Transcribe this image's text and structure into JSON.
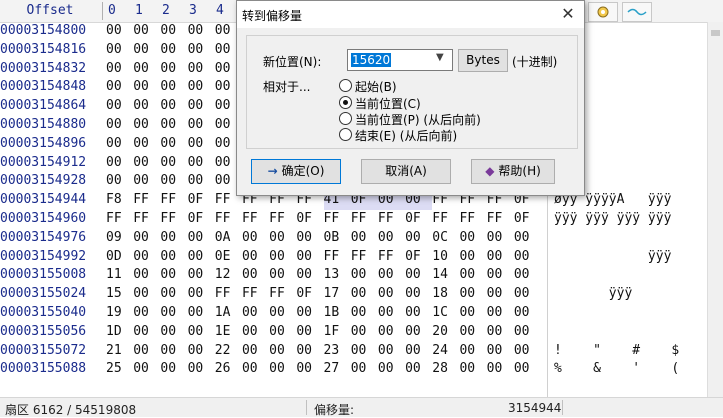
{
  "header": {
    "offset_label": "Offset",
    "columns": [
      "0",
      "1",
      "2",
      "3",
      "4"
    ]
  },
  "offsets": [
    "00003154800",
    "00003154816",
    "00003154832",
    "00003154848",
    "00003154864",
    "00003154880",
    "00003154896",
    "00003154912",
    "00003154928",
    "00003154944",
    "00003154960",
    "00003154976",
    "00003154992",
    "00003155008",
    "00003155024",
    "00003155040",
    "00003155056",
    "00003155072",
    "00003155088"
  ],
  "hex_rows": [
    [
      "00",
      "00",
      "00",
      "00",
      "00",
      "",
      "",
      "",
      "",
      "",
      "",
      "",
      "",
      "",
      "",
      ""
    ],
    [
      "00",
      "00",
      "00",
      "00",
      "00",
      "",
      "",
      "",
      "",
      "",
      "",
      "",
      "",
      "",
      "",
      ""
    ],
    [
      "00",
      "00",
      "00",
      "00",
      "00",
      "",
      "",
      "",
      "",
      "",
      "",
      "",
      "",
      "",
      "",
      ""
    ],
    [
      "00",
      "00",
      "00",
      "00",
      "00",
      "",
      "",
      "",
      "",
      "",
      "",
      "",
      "",
      "",
      "",
      ""
    ],
    [
      "00",
      "00",
      "00",
      "00",
      "00",
      "",
      "",
      "",
      "",
      "",
      "",
      "",
      "",
      "",
      "",
      ""
    ],
    [
      "00",
      "00",
      "00",
      "00",
      "00",
      "",
      "",
      "",
      "",
      "",
      "",
      "",
      "",
      "",
      "",
      ""
    ],
    [
      "00",
      "00",
      "00",
      "00",
      "00",
      "",
      "",
      "",
      "",
      "",
      "",
      "",
      "",
      "",
      "",
      ""
    ],
    [
      "00",
      "00",
      "00",
      "00",
      "00",
      "",
      "",
      "",
      "",
      "",
      "",
      "",
      "",
      "",
      "",
      ""
    ],
    [
      "00",
      "00",
      "00",
      "00",
      "00",
      "",
      "",
      "",
      "",
      "",
      "",
      "",
      "",
      "",
      "",
      ""
    ],
    [
      "F8",
      "FF",
      "FF",
      "0F",
      "FF",
      "FF",
      "FF",
      "FF",
      "41",
      "0F",
      "00",
      "00",
      "FF",
      "FF",
      "FF",
      "0F"
    ],
    [
      "FF",
      "FF",
      "FF",
      "0F",
      "FF",
      "FF",
      "FF",
      "0F",
      "FF",
      "FF",
      "FF",
      "0F",
      "FF",
      "FF",
      "FF",
      "0F"
    ],
    [
      "09",
      "00",
      "00",
      "00",
      "0A",
      "00",
      "00",
      "00",
      "0B",
      "00",
      "00",
      "00",
      "0C",
      "00",
      "00",
      "00"
    ],
    [
      "0D",
      "00",
      "00",
      "00",
      "0E",
      "00",
      "00",
      "00",
      "FF",
      "FF",
      "FF",
      "0F",
      "10",
      "00",
      "00",
      "00"
    ],
    [
      "11",
      "00",
      "00",
      "00",
      "12",
      "00",
      "00",
      "00",
      "13",
      "00",
      "00",
      "00",
      "14",
      "00",
      "00",
      "00"
    ],
    [
      "15",
      "00",
      "00",
      "00",
      "FF",
      "FF",
      "FF",
      "0F",
      "17",
      "00",
      "00",
      "00",
      "18",
      "00",
      "00",
      "00"
    ],
    [
      "19",
      "00",
      "00",
      "00",
      "1A",
      "00",
      "00",
      "00",
      "1B",
      "00",
      "00",
      "00",
      "1C",
      "00",
      "00",
      "00"
    ],
    [
      "1D",
      "00",
      "00",
      "00",
      "1E",
      "00",
      "00",
      "00",
      "1F",
      "00",
      "00",
      "00",
      "20",
      "00",
      "00",
      "00"
    ],
    [
      "21",
      "00",
      "00",
      "00",
      "22",
      "00",
      "00",
      "00",
      "23",
      "00",
      "00",
      "00",
      "24",
      "00",
      "00",
      "00"
    ],
    [
      "25",
      "00",
      "00",
      "00",
      "26",
      "00",
      "00",
      "00",
      "27",
      "00",
      "00",
      "00",
      "28",
      "00",
      "00",
      "00"
    ]
  ],
  "text_rows": [
    "",
    "",
    "",
    "",
    "",
    "",
    "",
    "",
    "",
    "øÿÿ ÿÿÿÿA   ÿÿÿ",
    "ÿÿÿ ÿÿÿ ÿÿÿ ÿÿÿ",
    "",
    "            ÿÿÿ",
    "",
    "       ÿÿÿ",
    "",
    "",
    "!    \"    #    $",
    "%    &    '    ("
  ],
  "status": {
    "sector": "扇区 6162 / 54519808",
    "offset_label": "偏移量:",
    "offset_value": "3154944"
  },
  "dialog": {
    "title": "转到偏移量",
    "close_glyph": "✕",
    "new_pos_label": "新位置(N):",
    "new_pos_value": "15620",
    "bytes_label": "Bytes",
    "hex_label": "(十进制)",
    "relative_label": "相对于...",
    "radios": [
      {
        "label": "起始(B)",
        "checked": false
      },
      {
        "label": "当前位置(C)",
        "checked": true
      },
      {
        "label": "当前位置(P) (从后向前)",
        "checked": false
      },
      {
        "label": "结束(E) (从后向前)",
        "checked": false
      }
    ],
    "ok_label": "确定(O)",
    "cancel_label": "取消(A)",
    "help_label": "帮助(H)"
  }
}
